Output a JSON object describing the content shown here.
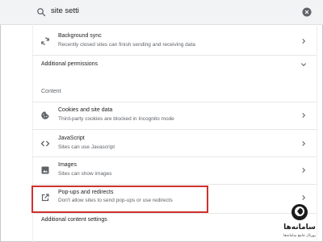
{
  "search": {
    "value": "site setti"
  },
  "icons": {
    "search": "search-icon",
    "clear": "close-icon",
    "sync": "sync-icon",
    "cookie": "cookie-icon",
    "javascript": "code-icon",
    "images": "image-icon",
    "popups": "open-in-new-icon",
    "chevron_right": "chevron-right-icon",
    "chevron_down": "chevron-down-icon"
  },
  "rows": {
    "background_sync": {
      "title": "Background sync",
      "subtitle": "Recently closed sites can finish sending and receiving data"
    },
    "additional_permissions": {
      "label": "Additional permissions"
    },
    "content_section": {
      "label": "Content"
    },
    "cookies": {
      "title": "Cookies and site data",
      "subtitle": "Third-party cookies are blocked in Incognito mode"
    },
    "javascript": {
      "title": "JavaScript",
      "subtitle": "Sites can use Javascript"
    },
    "images": {
      "title": "Images",
      "subtitle": "Sites can show images"
    },
    "popups": {
      "title": "Pop-ups and redirects",
      "subtitle": "Don't allow sites to send pop-ups or use redirects"
    },
    "additional_content": {
      "label": "Additional content settings"
    }
  },
  "watermark": {
    "text": "سامانه‌ها",
    "subtext": "پورتال جامع سامانه‌ها"
  },
  "colors": {
    "highlight": "#d0312d",
    "icon": "#5f6368",
    "text": "#202124",
    "subtext": "#5f6368"
  }
}
